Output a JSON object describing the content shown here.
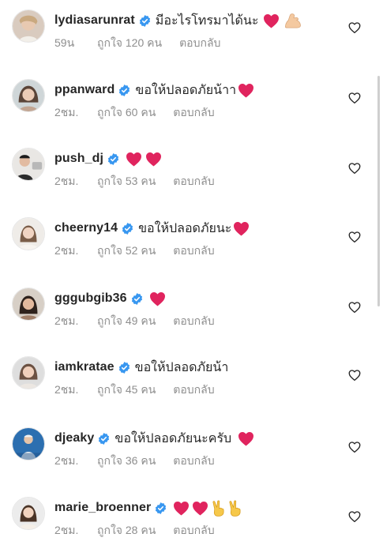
{
  "comments": [
    {
      "username": "lydiasarunrat",
      "verified": true,
      "text": "มีอะไรโทรมาได้นะ",
      "emojis": [
        "heart",
        "muscle"
      ],
      "time": "59น",
      "likes": "ถูกใจ 120 คน",
      "reply": "ตอบกลับ"
    },
    {
      "username": "ppanward",
      "verified": true,
      "text": "ขอให้ปลอดภัยน้าา",
      "emojis": [
        "heart"
      ],
      "time": "2ชม.",
      "likes": "ถูกใจ 60 คน",
      "reply": "ตอบกลับ"
    },
    {
      "username": "push_dj",
      "verified": true,
      "text": "",
      "emojis": [
        "heart",
        "heart"
      ],
      "time": "2ชม.",
      "likes": "ถูกใจ 53 คน",
      "reply": "ตอบกลับ"
    },
    {
      "username": "cheerny14",
      "verified": true,
      "text": "ขอให้ปลอดภัยนะ",
      "emojis": [
        "heart"
      ],
      "time": "2ชม.",
      "likes": "ถูกใจ 52 คน",
      "reply": "ตอบกลับ"
    },
    {
      "username": "gggubgib36",
      "verified": true,
      "text": "",
      "emojis": [
        "heart"
      ],
      "time": "2ชม.",
      "likes": "ถูกใจ 49 คน",
      "reply": "ตอบกลับ"
    },
    {
      "username": "iamkratae",
      "verified": true,
      "text": "ขอให้ปลอดภัยน้า",
      "emojis": [],
      "time": "2ชม.",
      "likes": "ถูกใจ 45 คน",
      "reply": "ตอบกลับ"
    },
    {
      "username": "djeaky",
      "verified": true,
      "text": "ขอให้ปลอดภัยนะครับ",
      "emojis": [
        "heart"
      ],
      "time": "2ชม.",
      "likes": "ถูกใจ 36 คน",
      "reply": "ตอบกลับ"
    },
    {
      "username": "marie_broenner",
      "verified": true,
      "text": "",
      "emojis": [
        "heart",
        "heart",
        "peace",
        "peace"
      ],
      "time": "2ชม.",
      "likes": "ถูกใจ 28 คน",
      "reply": "ตอบกลับ"
    }
  ],
  "colors": {
    "text": "#262626",
    "secondary": "#8e8e8e",
    "verified": "#3897f0",
    "heart": "#e0245e",
    "background": "#ffffff"
  },
  "icons": {
    "verified": "verified-badge-icon",
    "like": "heart-outline-icon",
    "heart_emoji": "red-heart-emoji",
    "muscle_emoji": "flexed-biceps-emoji",
    "peace_emoji": "victory-hand-emoji"
  }
}
